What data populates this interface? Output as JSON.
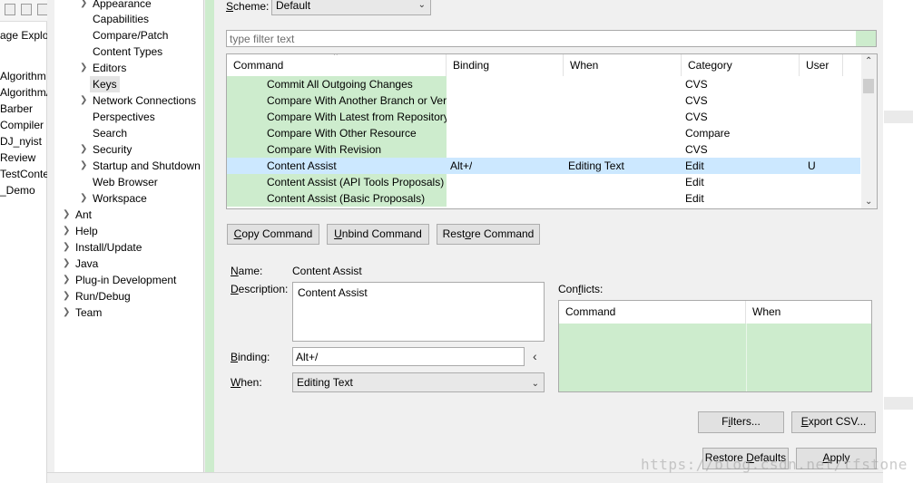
{
  "background_window": {
    "tab_label": "age Explor",
    "projects": [
      "Algorithm",
      "AlgorithmA",
      "Barber",
      "Compiler",
      "DJ_nyist",
      "Review",
      "TestConter",
      "_Demo"
    ]
  },
  "nav_tree": {
    "items": [
      {
        "label": "Appearance",
        "expandable": true
      },
      {
        "label": "Capabilities",
        "expandable": false
      },
      {
        "label": "Compare/Patch",
        "expandable": false
      },
      {
        "label": "Content Types",
        "expandable": false
      },
      {
        "label": "Editors",
        "expandable": true
      },
      {
        "label": "Keys",
        "expandable": false,
        "selected": true
      },
      {
        "label": "Network Connections",
        "expandable": true
      },
      {
        "label": "Perspectives",
        "expandable": false
      },
      {
        "label": "Search",
        "expandable": false
      },
      {
        "label": "Security",
        "expandable": true
      },
      {
        "label": "Startup and Shutdown",
        "expandable": true
      },
      {
        "label": "Web Browser",
        "expandable": false
      },
      {
        "label": "Workspace",
        "expandable": true
      }
    ],
    "top_items": [
      "Ant",
      "Help",
      "Install/Update",
      "Java",
      "Plug-in Development",
      "Run/Debug",
      "Team"
    ]
  },
  "keys_page": {
    "scheme_label_u": "S",
    "scheme_label_rest": "cheme:",
    "scheme_value": "Default",
    "filter_placeholder": "type filter text",
    "table": {
      "columns": [
        "Command",
        "Binding",
        "When",
        "Category",
        "User"
      ],
      "rows": [
        {
          "command": "Commit All Outgoing Changes",
          "binding": "",
          "when": "",
          "category": "CVS",
          "user": ""
        },
        {
          "command": "Compare With Another Branch or Ver",
          "binding": "",
          "when": "",
          "category": "CVS",
          "user": ""
        },
        {
          "command": "Compare With Latest from Repository",
          "binding": "",
          "when": "",
          "category": "CVS",
          "user": ""
        },
        {
          "command": "Compare With Other Resource",
          "binding": "",
          "when": "",
          "category": "Compare",
          "user": ""
        },
        {
          "command": "Compare With Revision",
          "binding": "",
          "when": "",
          "category": "CVS",
          "user": ""
        },
        {
          "command": "Content Assist",
          "binding": "Alt+/",
          "when": "Editing Text",
          "category": "Edit",
          "user": "U",
          "selected": true
        },
        {
          "command": "Content Assist (API Tools Proposals)",
          "binding": "",
          "when": "",
          "category": "Edit",
          "user": ""
        },
        {
          "command": "Content Assist (Basic Proposals)",
          "binding": "",
          "when": "",
          "category": "Edit",
          "user": ""
        }
      ]
    },
    "buttons": {
      "copy_u": "C",
      "copy_rest": "opy Command",
      "unbind_u": "U",
      "unbind_rest": "nbind Command",
      "restore_pre": "Rest",
      "restore_u": "o",
      "restore_rest": "re Command"
    },
    "details": {
      "name_label_u": "N",
      "name_label_rest": "ame:",
      "name_value": "Content Assist",
      "description_label_u": "D",
      "description_label_rest": "escription:",
      "description_value": "Content Assist",
      "binding_label_u": "B",
      "binding_label_rest": "inding:",
      "binding_value": "Alt+/",
      "binding_menu_glyph": "‹",
      "when_label_u": "W",
      "when_label_rest": "hen:",
      "when_value": "Editing Text"
    },
    "conflicts": {
      "label_pre": "Con",
      "label_u": "f",
      "label_rest": "licts:",
      "columns": [
        "Command",
        "When"
      ]
    },
    "filters_button": {
      "pre": "F",
      "u": "i",
      "rest": "lters..."
    },
    "export_button": {
      "u": "E",
      "rest": "xport CSV..."
    },
    "restore_defaults_label": {
      "pre": "Restore ",
      "u": "D",
      "rest": "efaults"
    },
    "apply_label": {
      "u": "A",
      "rest": "pply"
    }
  },
  "watermark": "https://blog.csdn.net/tfstone",
  "colors": {
    "green_highlight": "#cdeccd",
    "selection": "#cce8ff",
    "dialog_bg": "#f0f0f0"
  }
}
